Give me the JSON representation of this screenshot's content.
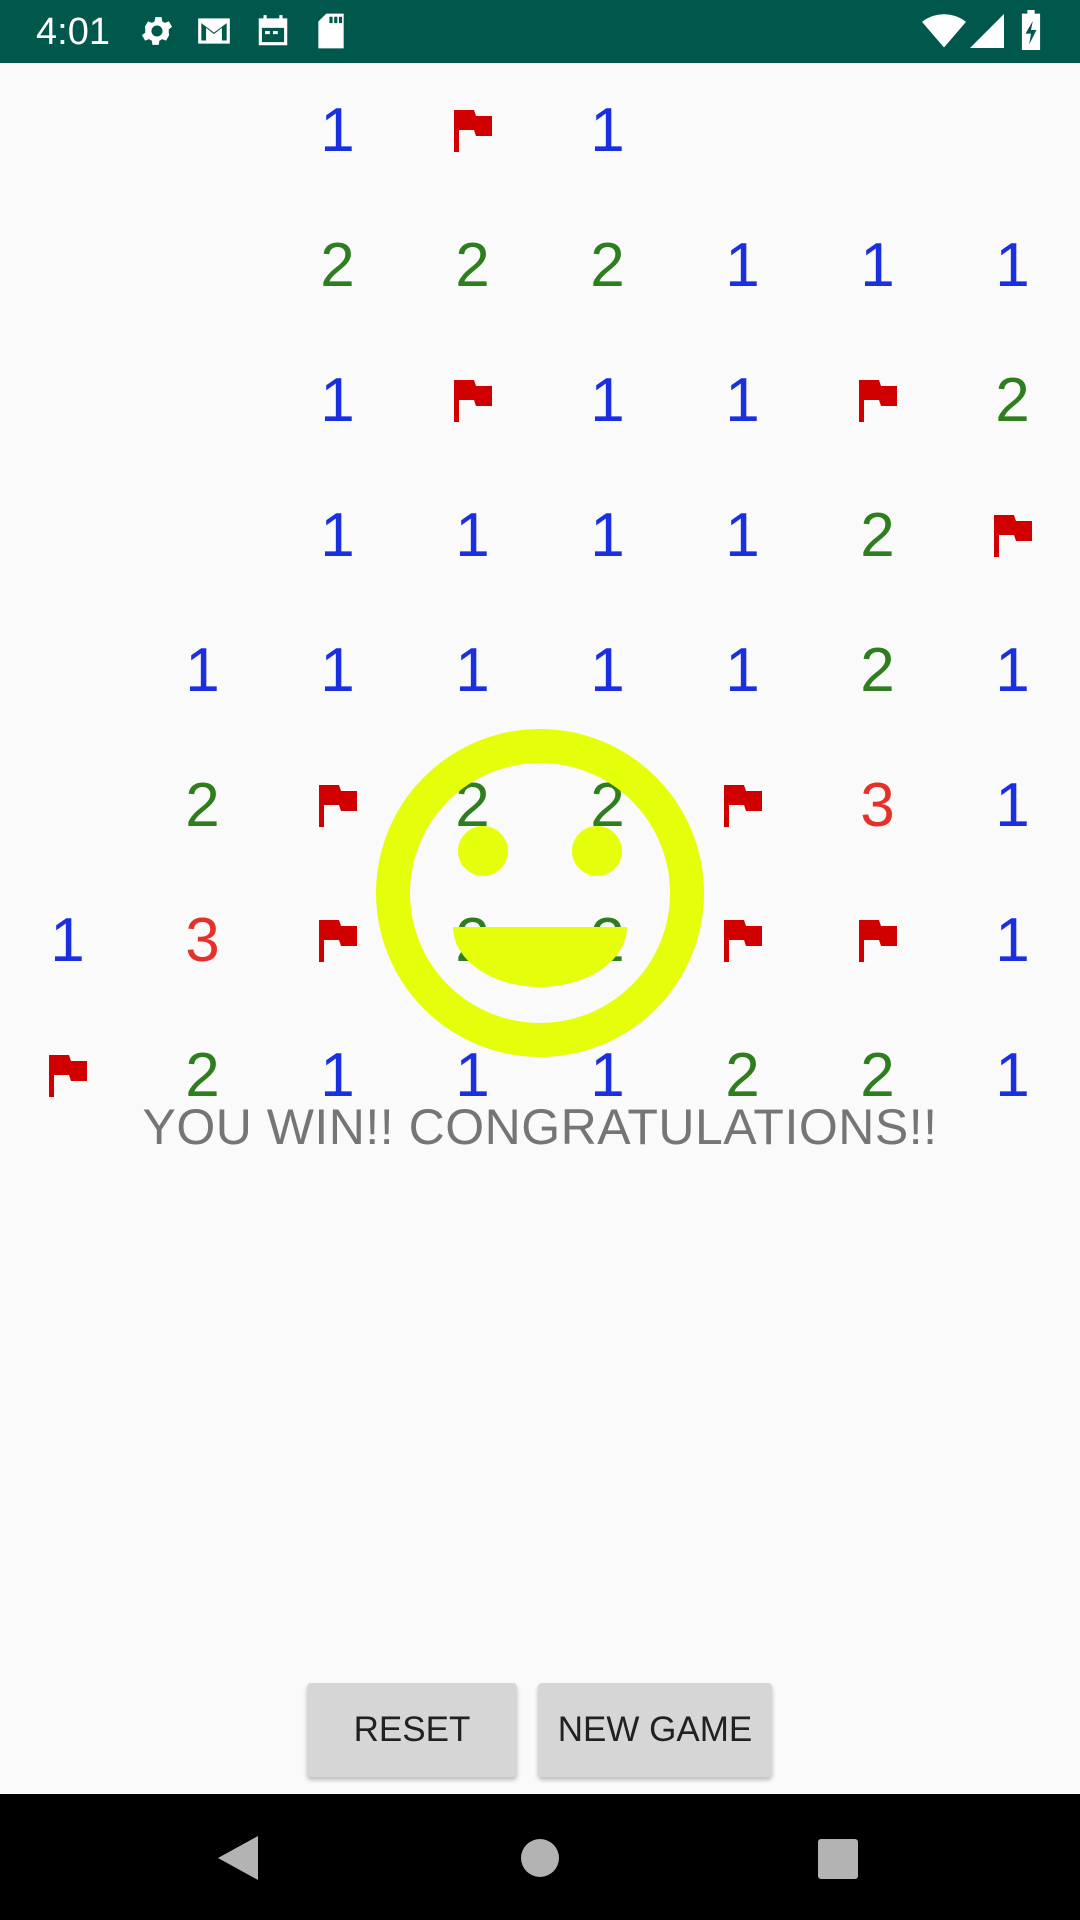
{
  "status_bar": {
    "time": "4:01",
    "left_icons": [
      "gear-icon",
      "gmail-icon",
      "calendar-icon",
      "sd-card-icon"
    ],
    "right_icons": [
      "wifi-icon",
      "cell-signal-icon",
      "battery-icon"
    ],
    "background": "#00574b"
  },
  "board": {
    "columns": 8,
    "rows": 8,
    "cells": [
      [
        "",
        "",
        "1",
        "F",
        "1",
        "",
        "",
        ""
      ],
      [
        "",
        "",
        "2",
        "2",
        "2",
        "1",
        "1",
        "1"
      ],
      [
        "",
        "",
        "1",
        "F",
        "1",
        "1",
        "F",
        "2"
      ],
      [
        "",
        "",
        "1",
        "1",
        "1",
        "1",
        "2",
        "F"
      ],
      [
        "",
        "1",
        "1",
        "1",
        "1",
        "1",
        "2",
        "1"
      ],
      [
        "",
        "2",
        "F",
        "2",
        "2",
        "F",
        "3",
        "1"
      ],
      [
        "1",
        "3",
        "F",
        "2",
        "2",
        "F",
        "F",
        "1"
      ],
      [
        "F",
        "2",
        "1",
        "1",
        "1",
        "2",
        "2",
        "1"
      ]
    ],
    "number_colors": {
      "1": "#1a2fe0",
      "2": "#2e7d1e",
      "3": "#e5312a"
    },
    "flag_color": "#d10000"
  },
  "smiley": {
    "icon": "smiley-face-icon",
    "color": "#e5ff0a"
  },
  "message": "YOU WIN!! CONGRATULATIONS!!",
  "buttons": {
    "reset": "RESET",
    "new_game": "NEW GAME"
  },
  "nav_bar": {
    "icons": [
      "back-icon",
      "home-icon",
      "recents-icon"
    ]
  }
}
